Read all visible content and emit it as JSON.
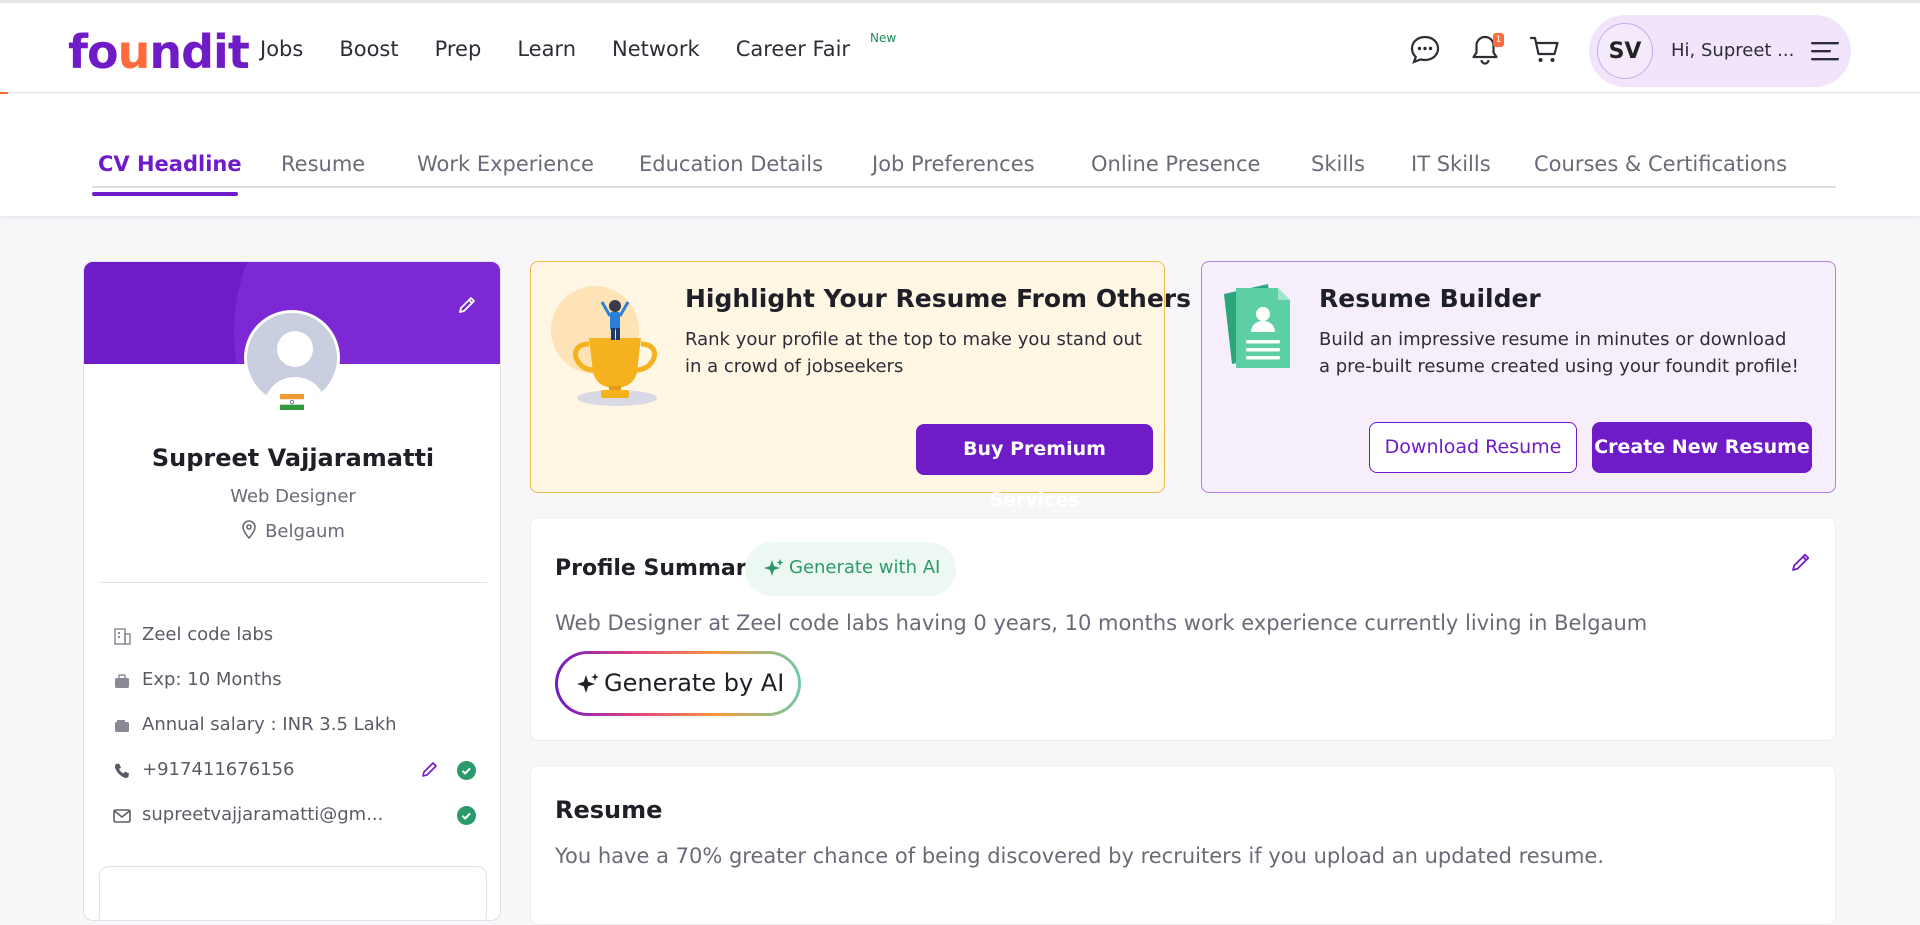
{
  "brand": {
    "logo_text_a": "fo",
    "logo_text_u": "u",
    "logo_text_b": "ndit",
    "accent": "#6f1bc8"
  },
  "nav": {
    "items": [
      "Jobs",
      "Boost",
      "Prep",
      "Learn",
      "Network",
      "Career Fair"
    ],
    "new_badge": "New",
    "notification_count": "1",
    "icons": [
      "chat-icon",
      "bell-icon",
      "cart-icon",
      "hamburger-menu-icon"
    ]
  },
  "user": {
    "initials": "SV",
    "greeting": "Hi, Supreet ..."
  },
  "tabs": [
    "CV Headline",
    "Resume",
    "Work Experience",
    "Education Details",
    "Job Preferences",
    "Online Presence",
    "Skills",
    "IT Skills",
    "Courses & Certifications"
  ],
  "profile": {
    "name": "Supreet Vajjaramatti",
    "role": "Web Designer",
    "location": "Belgaum",
    "company": "Zeel code labs",
    "experience": "Exp: 10 Months",
    "salary": "Annual salary : INR 3.5 Lakh",
    "phone": "+917411676156",
    "email": "supreetvajjaramatti@gm..."
  },
  "promo_premium": {
    "title": "Highlight Your Resume From Others",
    "desc": "Rank your profile at the top to make you stand out in a crowd of jobseekers",
    "button": "Buy Premium Services"
  },
  "promo_builder": {
    "title": "Resume Builder",
    "desc": "Build an impressive resume in minutes or download a pre-built resume created using your foundit profile!",
    "download_button": "Download Resume",
    "create_button": "Create New Resume"
  },
  "summary": {
    "title": "Profile Summary",
    "chip": "Generate with AI",
    "text": "Web Designer at Zeel code labs having 0 years, 10 months work experience currently living in Belgaum",
    "ai_button": "Generate by AI"
  },
  "resume_section": {
    "title": "Resume",
    "text": "You have a 70% greater chance of being discovered by recruiters if you upload an updated resume."
  }
}
